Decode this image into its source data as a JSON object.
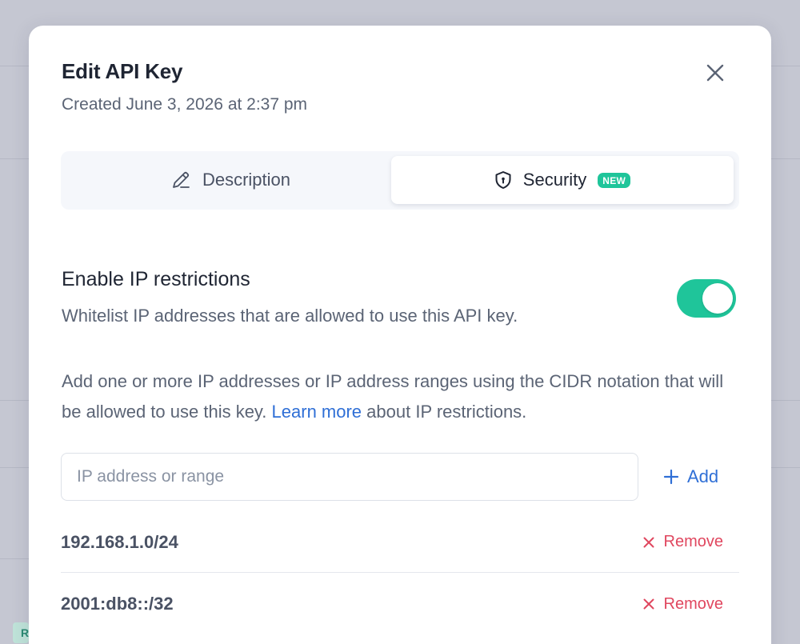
{
  "modal": {
    "title": "Edit API Key",
    "subtitle": "Created June 3, 2026 at 2:37 pm"
  },
  "tabs": [
    {
      "label": "Description",
      "icon": "pencil-icon",
      "active": false
    },
    {
      "label": "Security",
      "icon": "shield-icon",
      "active": true,
      "badge": "NEW"
    }
  ],
  "ip_restrictions": {
    "title": "Enable IP restrictions",
    "description": "Whitelist IP addresses that are allowed to use this API key.",
    "enabled": true,
    "info_before": "Add one or more IP addresses or IP address ranges using the CIDR notation that will be allowed to use this key. ",
    "info_link": "Learn more",
    "info_after": " about IP restrictions.",
    "input": {
      "placeholder": "IP address or range",
      "value": ""
    },
    "add_label": "Add",
    "remove_label": "Remove",
    "entries": [
      "192.168.1.0/24",
      "2001:db8::/32"
    ]
  },
  "background": {
    "badge_letter": "R"
  },
  "colors": {
    "accent_green": "#1fc59a",
    "link_blue": "#2f6fd6",
    "remove_red": "#e0475f",
    "overlay": "#c5c7d2"
  }
}
